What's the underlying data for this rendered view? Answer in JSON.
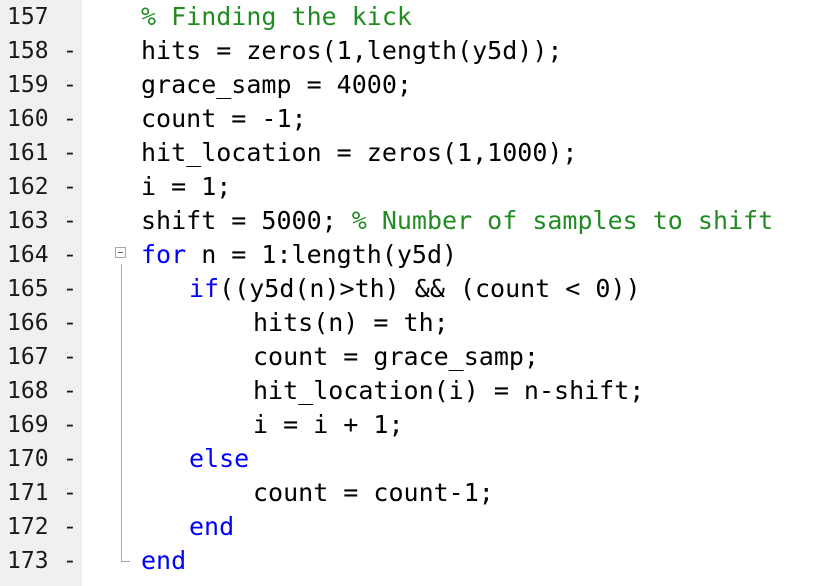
{
  "editor": {
    "colors": {
      "keyword": "#0000ff",
      "comment": "#228b22",
      "text": "#000000",
      "gutter": "#f0f0f0"
    },
    "lines": [
      {
        "number": "157",
        "marker": "",
        "indent": 0,
        "parts": [
          {
            "t": "c",
            "text": "% Finding the kick"
          }
        ]
      },
      {
        "number": "158",
        "marker": "-",
        "indent": 0,
        "parts": [
          {
            "t": "p",
            "text": "hits = zeros(1,length(y5d));"
          }
        ]
      },
      {
        "number": "159",
        "marker": "-",
        "indent": 0,
        "parts": [
          {
            "t": "p",
            "text": "grace_samp = 4000;"
          }
        ]
      },
      {
        "number": "160",
        "marker": "-",
        "indent": 0,
        "parts": [
          {
            "t": "p",
            "text": "count = -1;"
          }
        ]
      },
      {
        "number": "161",
        "marker": "-",
        "indent": 0,
        "parts": [
          {
            "t": "p",
            "text": "hit_location = zeros(1,1000);"
          }
        ]
      },
      {
        "number": "162",
        "marker": "-",
        "indent": 0,
        "parts": [
          {
            "t": "p",
            "text": "i = 1;"
          }
        ]
      },
      {
        "number": "163",
        "marker": "-",
        "indent": 0,
        "parts": [
          {
            "t": "p",
            "text": "shift = 5000; "
          },
          {
            "t": "c",
            "text": "% Number of samples to shift"
          }
        ]
      },
      {
        "number": "164",
        "marker": "-",
        "indent": 0,
        "parts": [
          {
            "t": "k",
            "text": "for"
          },
          {
            "t": "p",
            "text": " n = 1:length(y5d)"
          }
        ]
      },
      {
        "number": "165",
        "marker": "-",
        "indent": 1,
        "parts": [
          {
            "t": "k",
            "text": "if"
          },
          {
            "t": "p",
            "text": "((y5d(n)>th) && (count < 0))"
          }
        ]
      },
      {
        "number": "166",
        "marker": "-",
        "indent": 2,
        "parts": [
          {
            "t": "p",
            "text": "hits(n) = th;"
          }
        ]
      },
      {
        "number": "167",
        "marker": "-",
        "indent": 2,
        "parts": [
          {
            "t": "p",
            "text": "count = grace_samp;"
          }
        ]
      },
      {
        "number": "168",
        "marker": "-",
        "indent": 2,
        "parts": [
          {
            "t": "p",
            "text": "hit_location(i) = n-shift;"
          }
        ]
      },
      {
        "number": "169",
        "marker": "-",
        "indent": 2,
        "parts": [
          {
            "t": "p",
            "text": "i = i + 1;"
          }
        ]
      },
      {
        "number": "170",
        "marker": "-",
        "indent": 1,
        "parts": [
          {
            "t": "k",
            "text": "else"
          }
        ]
      },
      {
        "number": "171",
        "marker": "-",
        "indent": 2,
        "parts": [
          {
            "t": "p",
            "text": "count = count-1;"
          }
        ]
      },
      {
        "number": "172",
        "marker": "-",
        "indent": 1,
        "parts": [
          {
            "t": "k",
            "text": "end"
          }
        ]
      },
      {
        "number": "173",
        "marker": "-",
        "indent": 0,
        "parts": [
          {
            "t": "k",
            "text": "end"
          }
        ]
      }
    ]
  }
}
